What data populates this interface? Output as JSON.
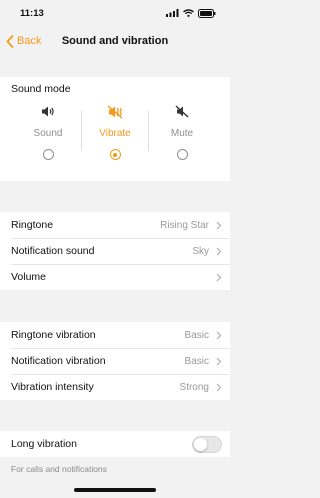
{
  "status_bar": {
    "time": "11:13"
  },
  "nav": {
    "back_label": "Back",
    "title": "Sound and vibration"
  },
  "sound_mode": {
    "title": "Sound mode",
    "options": [
      {
        "label": "Sound",
        "icon": "speaker-icon",
        "selected": false
      },
      {
        "label": "Vibrate",
        "icon": "vibrate-icon",
        "selected": true
      },
      {
        "label": "Mute",
        "icon": "mute-icon",
        "selected": false
      }
    ]
  },
  "sound_settings": [
    {
      "label": "Ringtone",
      "value": "Rising Star"
    },
    {
      "label": "Notification sound",
      "value": "Sky"
    },
    {
      "label": "Volume",
      "value": ""
    }
  ],
  "vibration_settings": [
    {
      "label": "Ringtone vibration",
      "value": "Basic"
    },
    {
      "label": "Notification vibration",
      "value": "Basic"
    },
    {
      "label": "Vibration intensity",
      "value": "Strong"
    }
  ],
  "long_vibration": {
    "label": "Long vibration",
    "enabled": false,
    "footnote": "For calls and notifications"
  },
  "colors": {
    "accent": "#f29a1b",
    "background": "#f2f2f2"
  }
}
